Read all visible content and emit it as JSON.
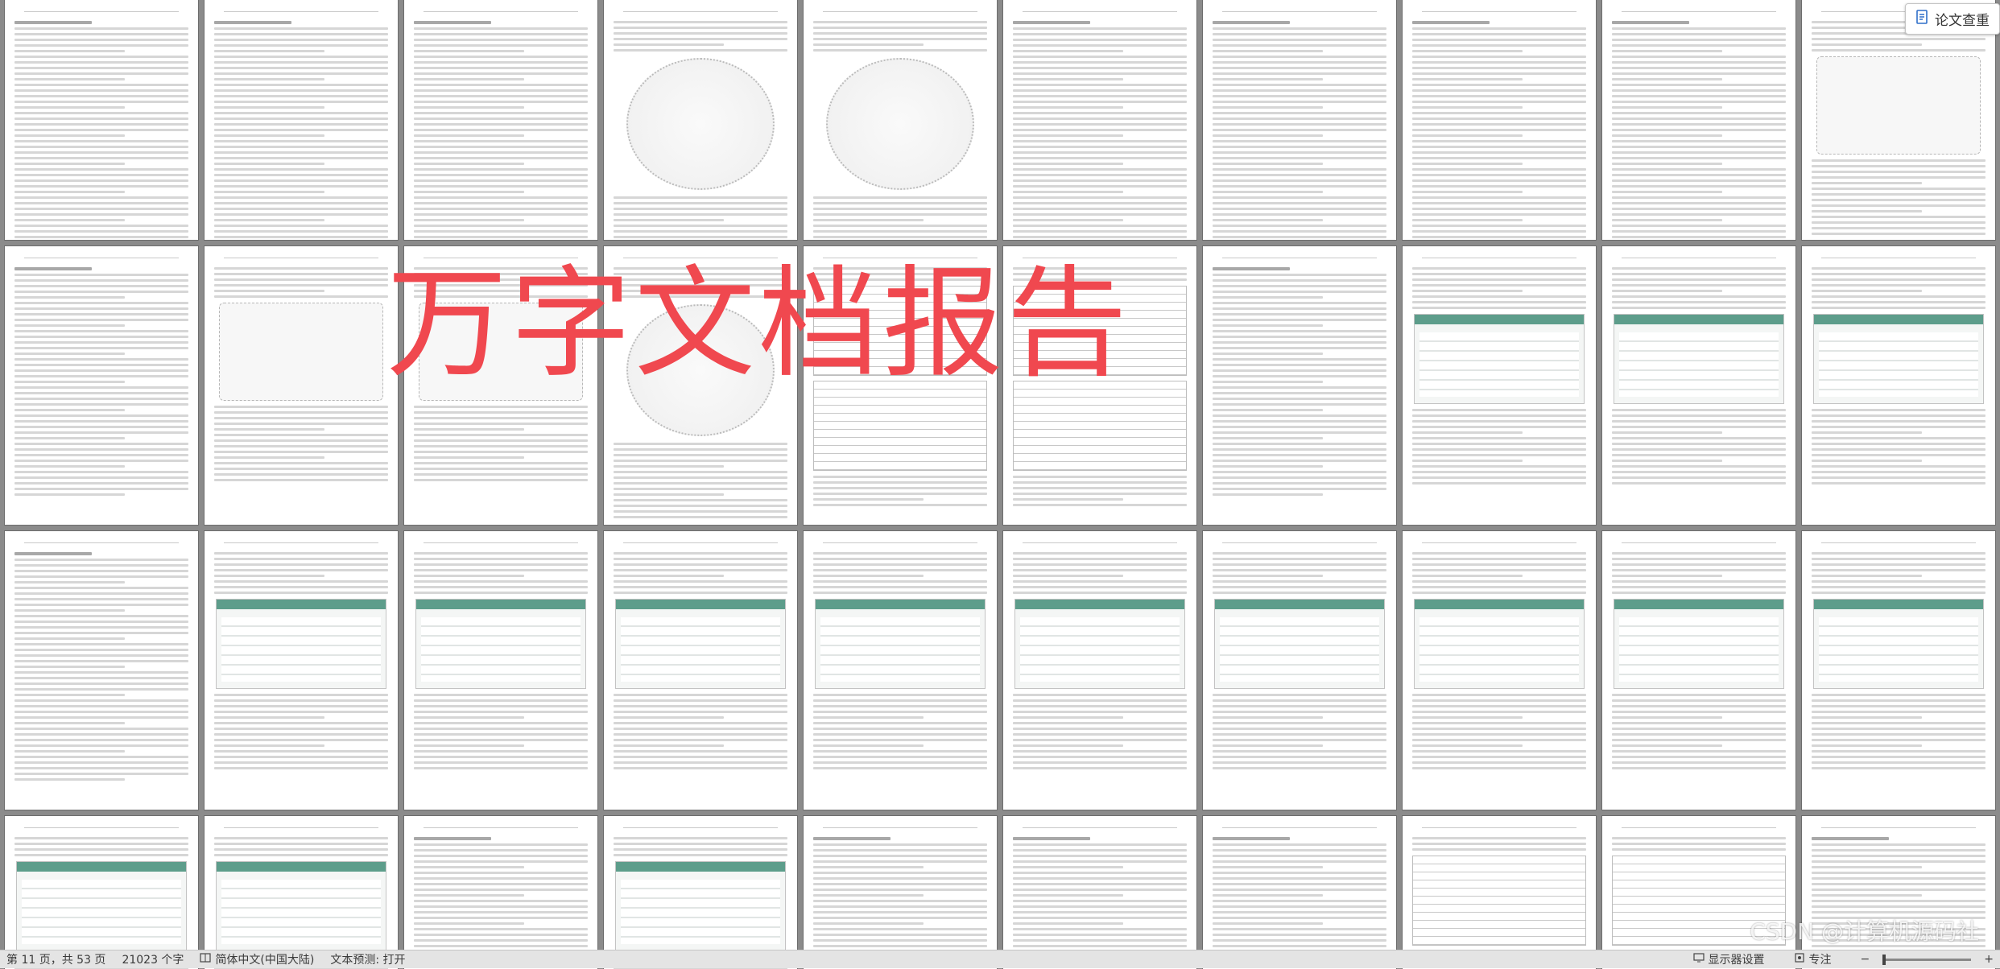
{
  "watermark": {
    "text": "万字文档报告",
    "color": "#f0484f"
  },
  "floating_button": {
    "label": "论文查重"
  },
  "status_bar": {
    "page_info": "第 11 页，共 53 页",
    "word_count": "21023 个字",
    "language": "简体中文(中国大陆)",
    "text_prediction": "文本预测: 打开",
    "display_settings": "显示器设置",
    "focus": "专注"
  },
  "overlay_brand": {
    "text": "CSDN @计算机源码社"
  },
  "colors": {
    "accent": "#5d9d8b",
    "background": "#8b8b8b",
    "watermark": "#f0484f"
  },
  "pages": {
    "row1": [
      "text",
      "text",
      "text",
      "mindmap",
      "mindmap",
      "text",
      "text",
      "text",
      "text",
      "diagram"
    ],
    "row2": [
      "text",
      "diagram",
      "diagram",
      "mindmap",
      "table",
      "table",
      "text",
      "screenshot",
      "screenshot",
      "screenshot"
    ],
    "row3": [
      "text",
      "screenshot",
      "screenshot",
      "screenshot",
      "screenshot",
      "screenshot",
      "screenshot",
      "screenshot",
      "screenshot",
      "screenshot"
    ],
    "row4": [
      "screenshot",
      "screenshot",
      "text",
      "screenshot",
      "text",
      "text",
      "text",
      "table",
      "table",
      "text"
    ]
  }
}
